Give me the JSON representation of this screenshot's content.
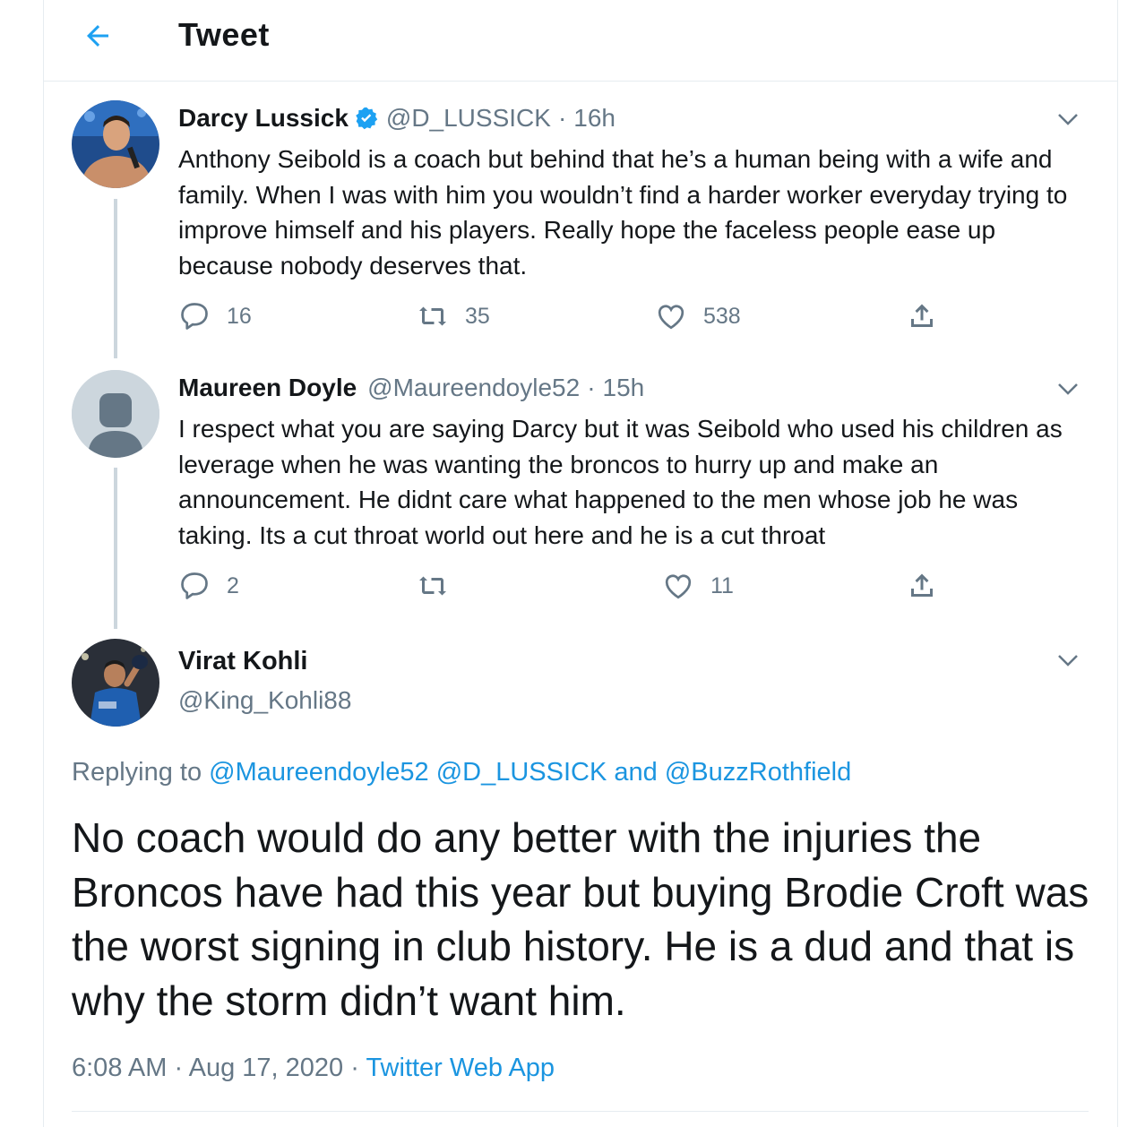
{
  "header": {
    "title": "Tweet",
    "back_icon": "arrow-left-icon"
  },
  "colors": {
    "accent": "#1da1f2",
    "link": "#1b95e0",
    "secondary": "#657786",
    "thread_line": "#ccd6dd"
  },
  "tweets": [
    {
      "name": "Darcy Lussick",
      "verified": true,
      "handle": "@D_LUSSICK",
      "separator": "·",
      "time": "16h",
      "text": "Anthony Seibold is a coach but behind that he’s a human being with a wife and family. When I was with him you wouldn’t find a harder worker everyday trying to improve himself and his players. Really hope the faceless people ease up because nobody deserves that.",
      "replies": "16",
      "retweets": "35",
      "likes": "538"
    },
    {
      "name": "Maureen Doyle",
      "verified": false,
      "handle": "@Maureendoyle52",
      "separator": "·",
      "time": "15h",
      "text": "I respect what you are saying Darcy but it was Seibold who used his children as leverage when he was wanting the broncos to hurry up and make an announcement.  He didnt care what happened to the men whose job he was taking. Its a cut throat world out here and he is a cut throat",
      "replies": "2",
      "retweets": "",
      "likes": "11"
    }
  ],
  "focused": {
    "name": "Virat Kohli",
    "handle": "@King_Kohli88",
    "replying_prefix": "Replying to",
    "replying_1": "@Maureendoyle52",
    "replying_2": "@D_LUSSICK",
    "replying_and": "and",
    "replying_3": "@BuzzRothfield",
    "text": "No coach would do any better with the injuries the Broncos have had this year but buying Brodie Croft was the worst signing in club history. He is a dud and that is why the storm didn’t want him.",
    "time": "6:08 AM",
    "date": "Aug 17, 2020",
    "separator": "·",
    "source": "Twitter Web App"
  }
}
